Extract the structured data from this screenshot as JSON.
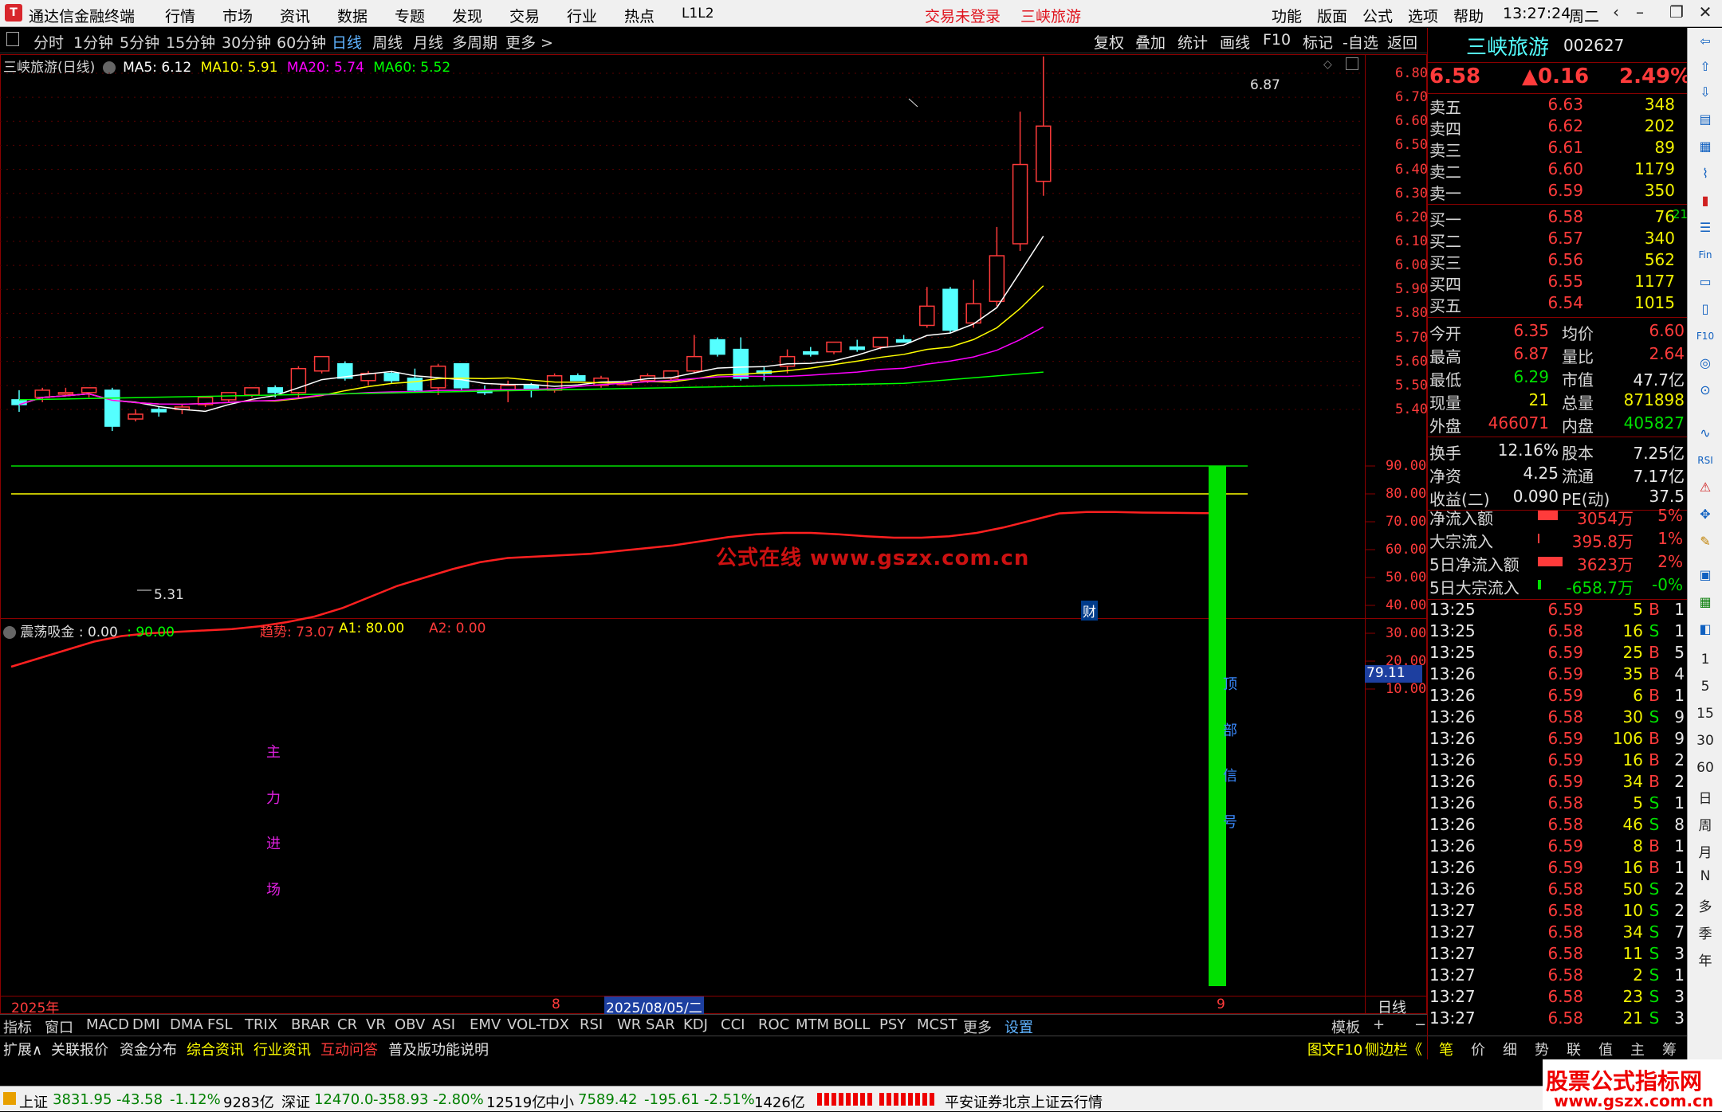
{
  "app": {
    "title": "通达信金融终端",
    "menu": [
      "行情",
      "市场",
      "资讯",
      "数据",
      "专题",
      "发现",
      "交易",
      "行业",
      "热点",
      "L1L2"
    ],
    "trade_status": "交易未登录",
    "stock_tab": "三峡旅游",
    "right_menu": [
      "功能",
      "版面",
      "公式",
      "选项",
      "帮助"
    ],
    "clock": "13:27:24",
    "weekday": "周二"
  },
  "toolbar": {
    "periods": [
      "分时",
      "1分钟",
      "5分钟",
      "15分钟",
      "30分钟",
      "60分钟",
      "日线",
      "周线",
      "月线",
      "多周期",
      "更多 >"
    ],
    "selected": "日线",
    "right_buttons": [
      "复权",
      "叠加",
      "统计",
      "画线",
      "F10",
      "标记",
      "-自选",
      "返回"
    ]
  },
  "main_chart": {
    "title": "三峡旅游(日线)",
    "ma": [
      {
        "label": "MA5: 6.12",
        "color": "#ffffff"
      },
      {
        "label": "MA10: 5.91",
        "color": "#ffff00"
      },
      {
        "label": "MA20: 5.74",
        "color": "#ff00ff"
      },
      {
        "label": "MA60: 5.52",
        "color": "#00ff00"
      }
    ],
    "y_ticks": [
      "6.80",
      "6.70",
      "6.60",
      "6.50",
      "6.40",
      "6.30",
      "6.20",
      "6.10",
      "6.00",
      "5.90",
      "5.80",
      "5.70",
      "5.60",
      "5.50",
      "5.40"
    ],
    "high_label": "6.87",
    "low_label": "5.31",
    "watermark": "公式在线 www.gszx.com.cn",
    "cai_badge": "财"
  },
  "indicator": {
    "name": "震荡吸金",
    "v1": ": 0.00",
    "v2": ": 90.00",
    "trend": "趋势: 73.07",
    "a1": "A1: 80.00",
    "a2": "A2: 0.00",
    "y_ticks": [
      "90.00",
      "80.00",
      "70.00",
      "60.00",
      "50.00",
      "40.00",
      "30.00",
      "20.00",
      "10.00"
    ],
    "current_value": "79.11",
    "text_left": [
      "主",
      "力",
      "进",
      "场"
    ],
    "text_signal": [
      "顶",
      "部",
      "信",
      "号"
    ]
  },
  "date_axis": {
    "year": "2025年",
    "mark8": "8",
    "cursor_date": "2025/08/05/二",
    "mark9": "9",
    "period": "日线"
  },
  "indicator_tabs": [
    "指标",
    "窗口",
    "MACD",
    "DMI",
    "DMA",
    "FSL",
    "TRIX",
    "BRAR",
    "CR",
    "VR",
    "OBV",
    "ASI",
    "EMV",
    "VOL-TDX",
    "RSI",
    "WR",
    "SAR",
    "KDJ",
    "CCI",
    "ROC",
    "MTM",
    "BOLL",
    "PSY",
    "MCST",
    "更多",
    "设置"
  ],
  "tab_right": [
    "模板",
    "+",
    "−"
  ],
  "bottom_tabs": [
    "扩展∧",
    "关联报价",
    "资金分布",
    "综合资讯",
    "行业资讯",
    "互动问答",
    "普及版功能说明"
  ],
  "bottom_right": [
    "图文F10",
    "侧边栏《"
  ],
  "quote": {
    "name": "三峡旅游",
    "code": "002627",
    "price": "6.58",
    "change": "▲0.16",
    "pct": "2.49%",
    "asks": [
      {
        "label": "卖五",
        "price": "6.63",
        "vol": "348"
      },
      {
        "label": "卖四",
        "price": "6.62",
        "vol": "202"
      },
      {
        "label": "卖三",
        "price": "6.61",
        "vol": "89"
      },
      {
        "label": "卖二",
        "price": "6.60",
        "vol": "1179"
      },
      {
        "label": "卖一",
        "price": "6.59",
        "vol": "350"
      }
    ],
    "bids": [
      {
        "label": "买一",
        "price": "6.58",
        "vol": "76",
        "delta": "-21"
      },
      {
        "label": "买二",
        "price": "6.57",
        "vol": "340",
        "delta": ""
      },
      {
        "label": "买三",
        "price": "6.56",
        "vol": "562",
        "delta": ""
      },
      {
        "label": "买四",
        "price": "6.55",
        "vol": "1177",
        "delta": ""
      },
      {
        "label": "买五",
        "price": "6.54",
        "vol": "1015",
        "delta": ""
      }
    ],
    "stats": [
      {
        "l1": "今开",
        "v1": "6.35",
        "l2": "均价",
        "v2": "6.60"
      },
      {
        "l1": "最高",
        "v1": "6.87",
        "l2": "量比",
        "v2": "2.64"
      },
      {
        "l1": "最低",
        "v1": "6.29",
        "l2": "市值",
        "v2": "47.7亿"
      },
      {
        "l1": "现量",
        "v1": "21",
        "l2": "总量",
        "v2": "871898"
      },
      {
        "l1": "外盘",
        "v1": "466071",
        "l2": "内盘",
        "v2": "405827"
      }
    ],
    "stats2": [
      {
        "l1": "换手",
        "v1": "12.16%",
        "l2": "股本",
        "v2": "7.25亿"
      },
      {
        "l1": "净资",
        "v1": "4.25",
        "l2": "流通",
        "v2": "7.17亿"
      },
      {
        "l1": "收益(二)",
        "v1": "0.090",
        "l2": "PE(动)",
        "v2": "37.5"
      }
    ],
    "flows": [
      {
        "label": "净流入额",
        "value": "3054万",
        "pct": "5%",
        "bar": 0.7,
        "color": "#ff3b3b"
      },
      {
        "label": "大宗流入",
        "value": "395.8万",
        "pct": "1%",
        "bar": 0.06,
        "color": "#ff3b3b"
      },
      {
        "label": "5日净流入额",
        "value": "3623万",
        "pct": "2%",
        "bar": 0.85,
        "color": "#ff3b3b"
      },
      {
        "label": "5日大宗流入",
        "value": "-658.7万",
        "pct": "-0%",
        "bar": 0.1,
        "color": "#00e000"
      }
    ],
    "ticks": [
      {
        "t": "13:25",
        "p": "6.59",
        "v": "5",
        "bs": "B",
        "n": "1"
      },
      {
        "t": "13:25",
        "p": "6.58",
        "v": "16",
        "bs": "S",
        "n": "1"
      },
      {
        "t": "13:25",
        "p": "6.59",
        "v": "25",
        "bs": "B",
        "n": "5"
      },
      {
        "t": "13:26",
        "p": "6.59",
        "v": "35",
        "bs": "B",
        "n": "4"
      },
      {
        "t": "13:26",
        "p": "6.59",
        "v": "6",
        "bs": "B",
        "n": "1"
      },
      {
        "t": "13:26",
        "p": "6.58",
        "v": "30",
        "bs": "S",
        "n": "9"
      },
      {
        "t": "13:26",
        "p": "6.59",
        "v": "106",
        "bs": "B",
        "n": "9"
      },
      {
        "t": "13:26",
        "p": "6.59",
        "v": "16",
        "bs": "B",
        "n": "2"
      },
      {
        "t": "13:26",
        "p": "6.59",
        "v": "34",
        "bs": "B",
        "n": "2"
      },
      {
        "t": "13:26",
        "p": "6.58",
        "v": "5",
        "bs": "S",
        "n": "1"
      },
      {
        "t": "13:26",
        "p": "6.58",
        "v": "46",
        "bs": "S",
        "n": "8"
      },
      {
        "t": "13:26",
        "p": "6.59",
        "v": "8",
        "bs": "B",
        "n": "1"
      },
      {
        "t": "13:26",
        "p": "6.59",
        "v": "16",
        "bs": "B",
        "n": "1"
      },
      {
        "t": "13:26",
        "p": "6.58",
        "v": "50",
        "bs": "S",
        "n": "2"
      },
      {
        "t": "13:27",
        "p": "6.58",
        "v": "10",
        "bs": "S",
        "n": "2"
      },
      {
        "t": "13:27",
        "p": "6.58",
        "v": "34",
        "bs": "S",
        "n": "7"
      },
      {
        "t": "13:27",
        "p": "6.58",
        "v": "11",
        "bs": "S",
        "n": "3"
      },
      {
        "t": "13:27",
        "p": "6.58",
        "v": "2",
        "bs": "S",
        "n": "1"
      },
      {
        "t": "13:27",
        "p": "6.58",
        "v": "23",
        "bs": "S",
        "n": "3"
      },
      {
        "t": "13:27",
        "p": "6.58",
        "v": "21",
        "bs": "S",
        "n": "3"
      }
    ],
    "tick_tabs": [
      "笔",
      "价",
      "细",
      "势",
      "联",
      "值",
      "主",
      "筹"
    ]
  },
  "sidebar": {
    "labels": [
      "1",
      "5",
      "15",
      "30",
      "60",
      "日",
      "周",
      "月",
      "N",
      "多",
      "季",
      "年"
    ]
  },
  "statusbar": {
    "sh_label": "上证",
    "sh_val": "3831.95",
    "sh_chg": "-43.58",
    "sh_pct": "-1.12%",
    "sh_amt": "9283亿",
    "sz_label": "深证",
    "sz_val": "12470.0",
    "sz_chg": "-358.93",
    "sz_pct": "-2.80%",
    "sz_amt": "12519亿",
    "zx_label": "中小",
    "zx_val": "7589.42",
    "zx_chg": "-195.61",
    "zx_pct": "-2.51%",
    "zx_amt": "1426亿",
    "broker": "平安证券北京上证云行情"
  },
  "brand": {
    "line1": "股票公式指标网",
    "line2": "www.gszx.com.cn"
  },
  "colors": {
    "up": "#ff3b3b",
    "down": "#55ffff",
    "ma5": "#ffffff",
    "ma10": "#ffff00",
    "ma20": "#ff00ff",
    "ma60": "#00ff00",
    "ind_line": "#ff2020",
    "signal": "#00e000"
  }
}
